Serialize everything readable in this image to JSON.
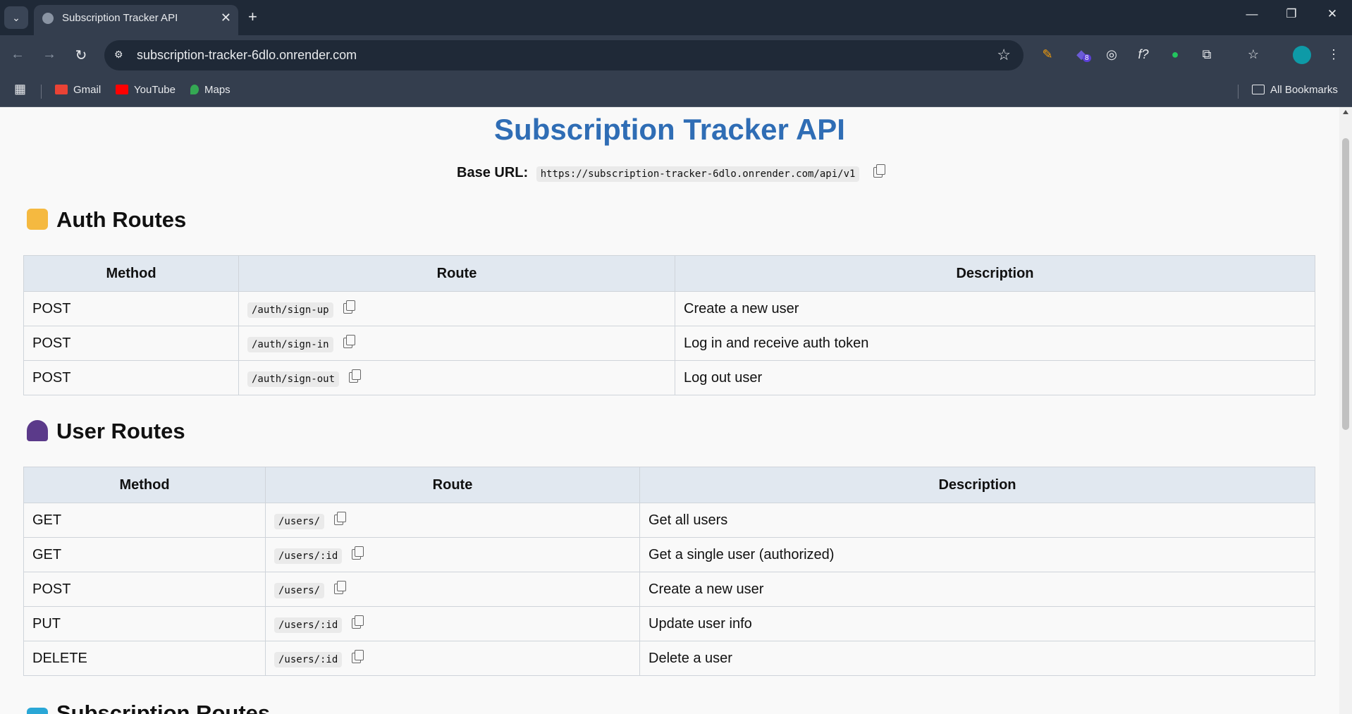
{
  "browser": {
    "tab_title": "Subscription Tracker API",
    "url": "subscription-tracker-6dlo.onrender.com",
    "bookmarks": [
      "Gmail",
      "YouTube",
      "Maps"
    ],
    "all_bookmarks": "All Bookmarks",
    "extension_badge": "8"
  },
  "page": {
    "title": "Subscription Tracker API",
    "base_url_label": "Base URL:",
    "base_url": "https://subscription-tracker-6dlo.onrender.com/api/v1"
  },
  "sections": [
    {
      "heading": "Auth Routes",
      "icon": "lock-icon",
      "columns": [
        "Method",
        "Route",
        "Description"
      ],
      "rows": [
        [
          "POST",
          "/auth/sign-up",
          "Create a new user"
        ],
        [
          "POST",
          "/auth/sign-in",
          "Log in and receive auth token"
        ],
        [
          "POST",
          "/auth/sign-out",
          "Log out user"
        ]
      ]
    },
    {
      "heading": "User Routes",
      "icon": "user-icon",
      "columns": [
        "Method",
        "Route",
        "Description"
      ],
      "rows": [
        [
          "GET",
          "/users/",
          "Get all users"
        ],
        [
          "GET",
          "/users/:id",
          "Get a single user (authorized)"
        ],
        [
          "POST",
          "/users/",
          "Create a new user"
        ],
        [
          "PUT",
          "/users/:id",
          "Update user info"
        ],
        [
          "DELETE",
          "/users/:id",
          "Delete a user"
        ]
      ]
    },
    {
      "heading": "Subscription Routes",
      "icon": "card-icon"
    }
  ]
}
